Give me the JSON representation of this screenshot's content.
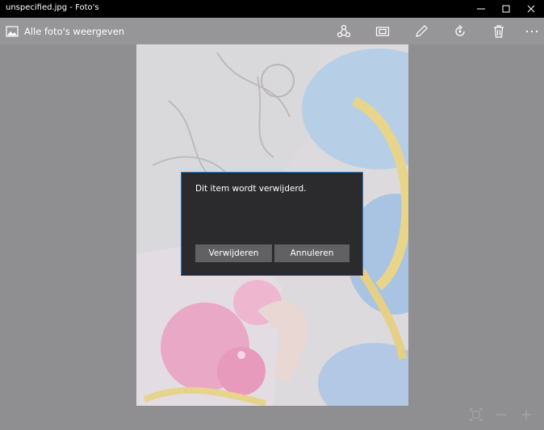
{
  "window": {
    "title": "unspecified.jpg - Foto's",
    "controls": [
      "minimize-icon",
      "maximize-icon",
      "close-icon"
    ]
  },
  "toolbar": {
    "back_label": "Alle foto's weergeven",
    "tools": [
      "share-icon",
      "slideshow-icon",
      "edit-pencil-icon",
      "rotate-icon",
      "delete-icon",
      "more-icon"
    ]
  },
  "dialog": {
    "message": "Dit item wordt verwijderd.",
    "confirm_label": "Verwijderen",
    "cancel_label": "Annuleren",
    "accent_color": "#2f79c8"
  },
  "zoom_controls": [
    "fit-icon",
    "zoom-out-icon",
    "zoom-in-icon"
  ]
}
